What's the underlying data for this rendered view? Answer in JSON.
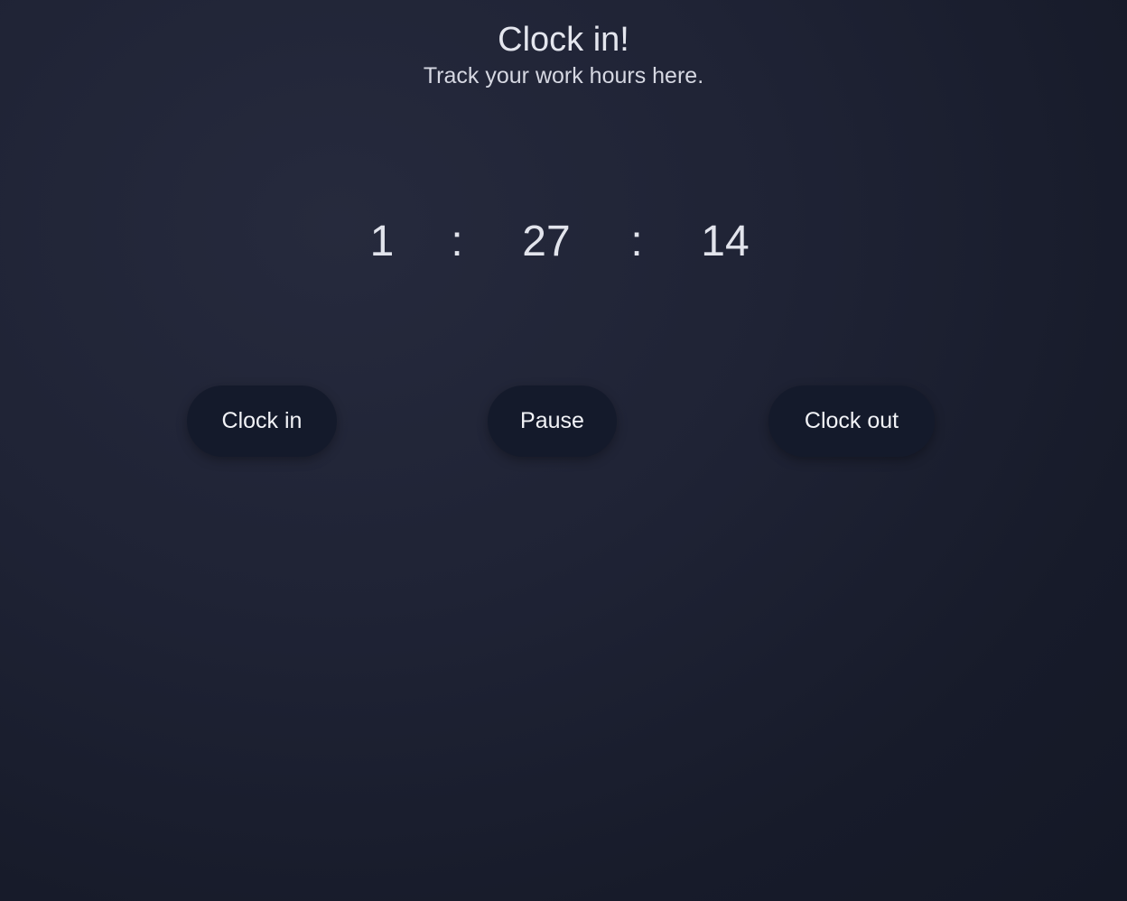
{
  "header": {
    "title": "Clock in!",
    "subtitle": "Track your work hours here."
  },
  "timer": {
    "hours": "1",
    "separator": ":",
    "minutes": "27",
    "seconds": "14"
  },
  "buttons": {
    "clock_in": "Clock in",
    "pause": "Pause",
    "clock_out": "Clock out"
  }
}
